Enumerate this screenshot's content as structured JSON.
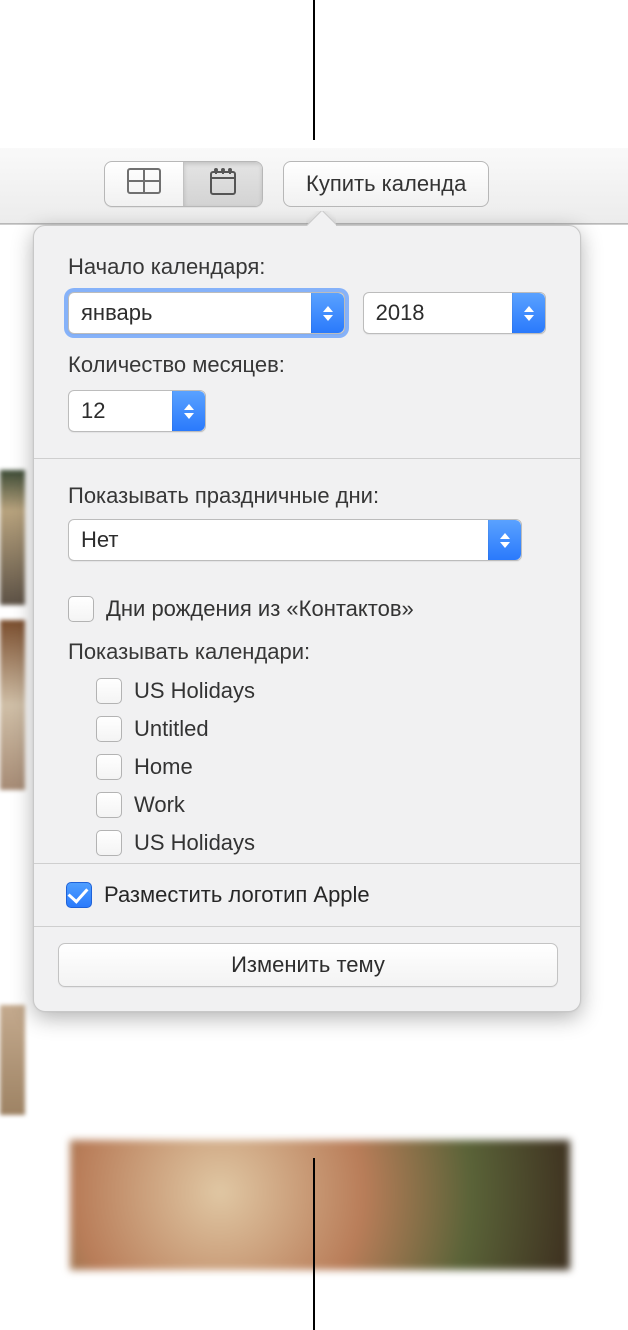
{
  "toolbar": {
    "buy_label": "Купить календа"
  },
  "popover": {
    "start_label": "Начало календаря:",
    "month_value": "январь",
    "year_value": "2018",
    "months_count_label": "Количество месяцев:",
    "months_count_value": "12",
    "holidays_label": "Показывать праздничные дни:",
    "holidays_value": "Нет",
    "birthdays_label": "Дни рождения из «Контактов»",
    "show_calendars_label": "Показывать календари:",
    "calendars": [
      {
        "label": "US Holidays",
        "checked": false
      },
      {
        "label": "Untitled",
        "checked": false
      },
      {
        "label": "Home",
        "checked": false
      },
      {
        "label": "Work",
        "checked": false
      },
      {
        "label": "US Holidays",
        "checked": false
      }
    ],
    "apple_logo_label": "Разместить логотип Apple",
    "apple_logo_checked": true,
    "change_theme_label": "Изменить тему"
  }
}
